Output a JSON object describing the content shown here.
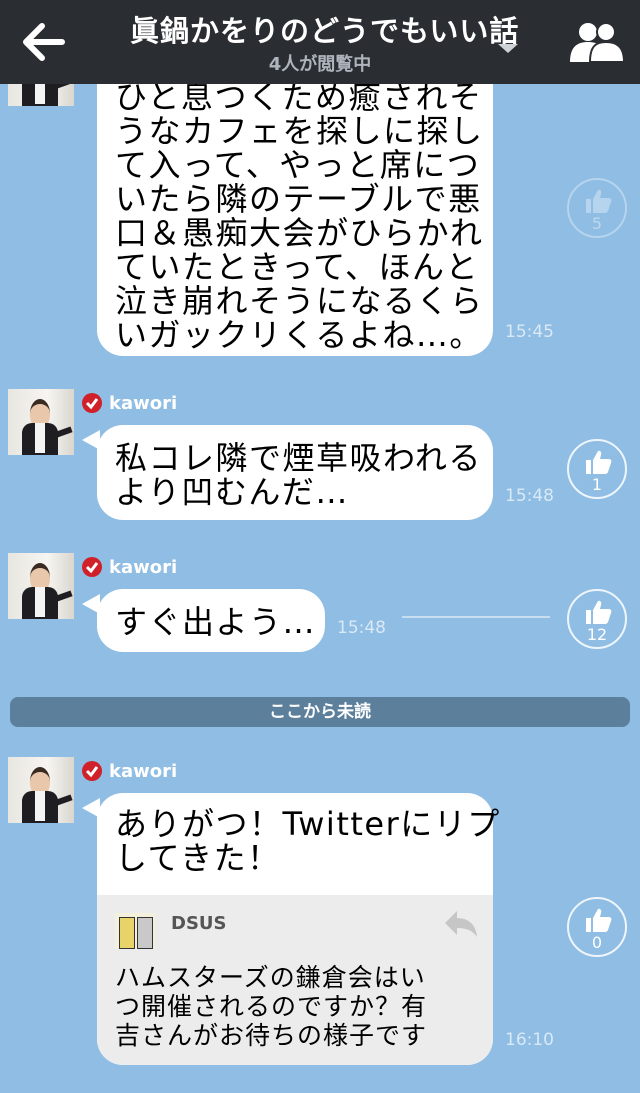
{
  "header": {
    "title": "眞鍋かをりのどうでもいい話",
    "subtitle": "4人が閲覧中"
  },
  "messages": [
    {
      "text": "ひと息つくため癒されそ\nうなカフェを探しに探し\nて入って、やっと席につ\nいたら隣のテーブルで悪\n口＆愚痴大会がひらかれ\nていたときって、ほんと\n泣き崩れそうになるくら\nいガックリくるよね…。",
      "time": "15:45",
      "likes": "5"
    },
    {
      "sender": "kawori",
      "text": "私コレ隣で煙草吸われる\nより凹むんだ…",
      "time": "15:48",
      "likes": "1"
    },
    {
      "sender": "kawori",
      "text": "すぐ出よう…",
      "time": "15:48",
      "likes": "12"
    },
    {
      "sender": "kawori",
      "text": "ありがつ！Twitterにリプ\nしてきた！",
      "reply_user": "DSUS",
      "reply_text": "ハムスターズの鎌倉会はい\nつ開催されるのですか？有\n吉さんがお待ちの様子です",
      "time": "16:10",
      "likes": "0"
    }
  ],
  "unread_label": "ここから未読",
  "colors": {
    "background": "#8fbde3",
    "header": "#2a2e33",
    "unread_bar": "#5c7f9c",
    "badge": "#d0202a"
  }
}
